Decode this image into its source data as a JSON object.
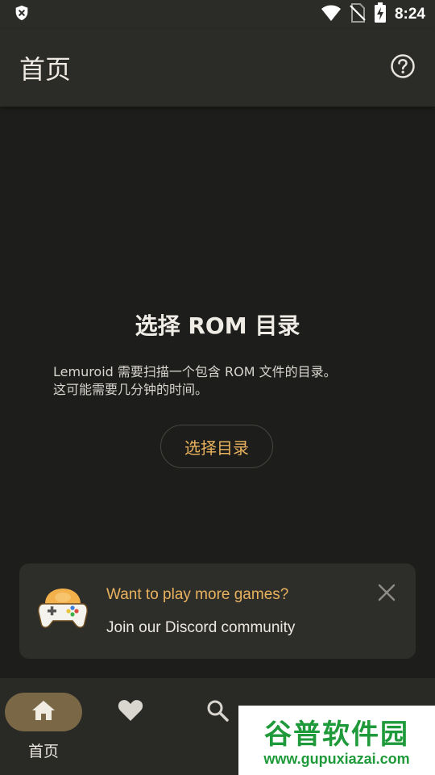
{
  "status_bar": {
    "time": "8:24",
    "icons": [
      "shield-x-icon",
      "wifi-icon",
      "no-sim-icon",
      "battery-charging-icon"
    ]
  },
  "app_bar": {
    "title": "首页",
    "help_icon": "help-circle-icon"
  },
  "main": {
    "title": "选择 ROM 目录",
    "description_line1": "Lemuroid 需要扫描一个包含 ROM 文件的目录。",
    "description_line2": "这可能需要几分钟的时间。",
    "select_button": "选择目录"
  },
  "promo": {
    "icon": "gamepad-face-icon",
    "title": "Want to play more games?",
    "subtitle": "Join our Discord community",
    "close_icon": "close-icon"
  },
  "bottom_nav": {
    "items": [
      {
        "label": "首页",
        "icon": "home-icon",
        "active": true
      },
      {
        "label": "",
        "icon": "heart-icon",
        "active": false
      },
      {
        "label": "",
        "icon": "search-icon",
        "active": false
      }
    ]
  },
  "watermark": {
    "title": "谷普软件园",
    "url": "www.gupuxiazai.com"
  },
  "colors": {
    "background": "#1d1d1b",
    "app_bar": "#2b2b28",
    "accent": "#e9b25e",
    "nav_pill": "#7a6746",
    "watermark_green": "#1f9a3a"
  }
}
